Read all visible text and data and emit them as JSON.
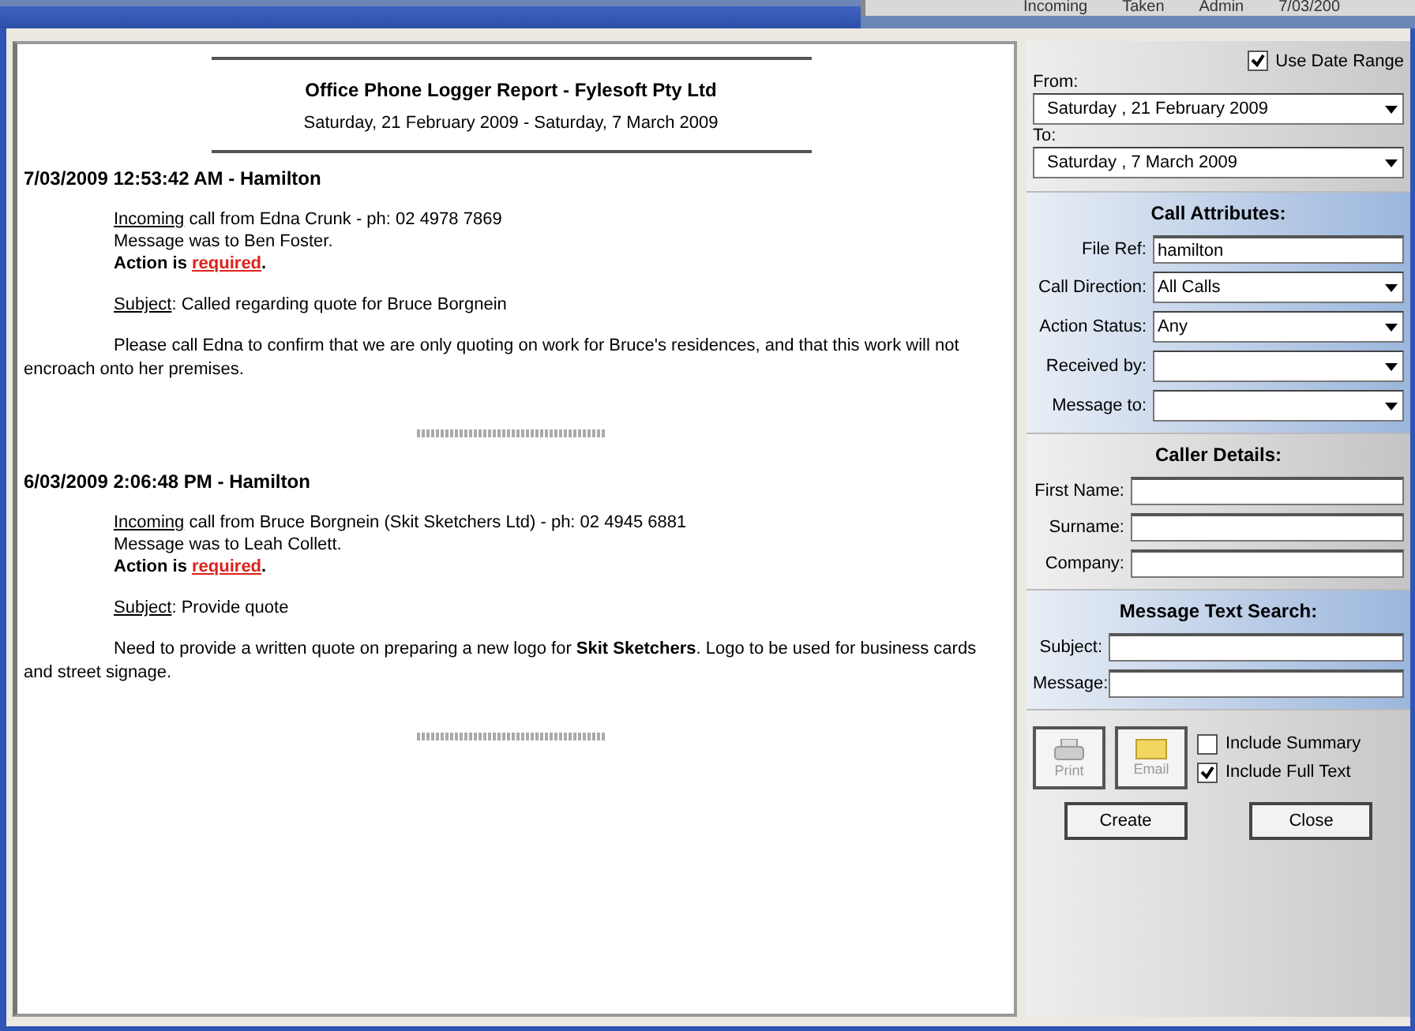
{
  "background_window": {
    "cells": [
      "Incoming",
      "Taken",
      "Admin",
      "7/03/200"
    ]
  },
  "report": {
    "title": "Office Phone Logger Report - Fylesoft Pty Ltd",
    "range": "Saturday, 21 February 2009 - Saturday, 7 March 2009",
    "entries": [
      {
        "heading": "7/03/2009 12:53:42 AM - Hamilton",
        "direction": "Incoming",
        "call": " call from Edna Crunk - ph: 02 4978 7869",
        "message": "Message was to Ben Foster.",
        "action_label": "Action is",
        "action_status": "required",
        "action_end": ".",
        "subject_label": "Subject",
        "subject": ": Called regarding quote for Bruce Borgnein",
        "body": "Please call Edna to confirm that we are only quoting on work for Bruce's residences, and that this work will not encroach onto her premises."
      },
      {
        "heading": "6/03/2009 2:06:48 PM - Hamilton",
        "direction": "Incoming",
        "call": " call from Bruce Borgnein (Skit Sketchers Ltd) - ph: 02 4945 6881",
        "message": "Message was to Leah Collett.",
        "action_label": "Action is",
        "action_status": "required",
        "action_end": ".",
        "subject_label": "Subject",
        "subject": ": Provide quote",
        "body": "Need to provide a written quote on preparing a new logo for **Skit Sketchers**. Logo to be used for business cards and street signage."
      }
    ]
  },
  "date_range": {
    "use_label": "Use Date Range",
    "checked": true,
    "from_label": "From:",
    "from": "Saturday , 21 February 2009",
    "to_label": "To:",
    "to": "Saturday , 7 March 2009"
  },
  "sections": [
    {
      "title": "Call Attributes:",
      "fields": [
        {
          "label": "File Ref:",
          "kind": "text",
          "value": "hamilton"
        },
        {
          "label": "Call Direction:",
          "kind": "select",
          "value": "All Calls"
        },
        {
          "label": "Action Status:",
          "kind": "select",
          "value": "Any"
        },
        {
          "label": "Received by:",
          "kind": "select"
        },
        {
          "label": "Message to:",
          "kind": "select"
        }
      ]
    },
    {
      "title": "Caller Details:",
      "fields": [
        {
          "label": "First Name:",
          "kind": "text"
        },
        {
          "label": "Surname:",
          "kind": "text"
        },
        {
          "label": "Company:",
          "kind": "text"
        }
      ]
    },
    {
      "title": "Message Text Search:",
      "fields": [
        {
          "label": "Subject:",
          "kind": "text"
        },
        {
          "label": "Message:",
          "kind": "text"
        }
      ]
    }
  ],
  "output": {
    "print": {
      "label": "Print",
      "disabled": true
    },
    "email": {
      "label": "Email",
      "disabled": true
    },
    "options": [
      {
        "label": "Include Summary",
        "checked": false
      },
      {
        "label": "Include Full Text",
        "checked": true
      }
    ]
  },
  "buttons": [
    "Create",
    "Close"
  ]
}
